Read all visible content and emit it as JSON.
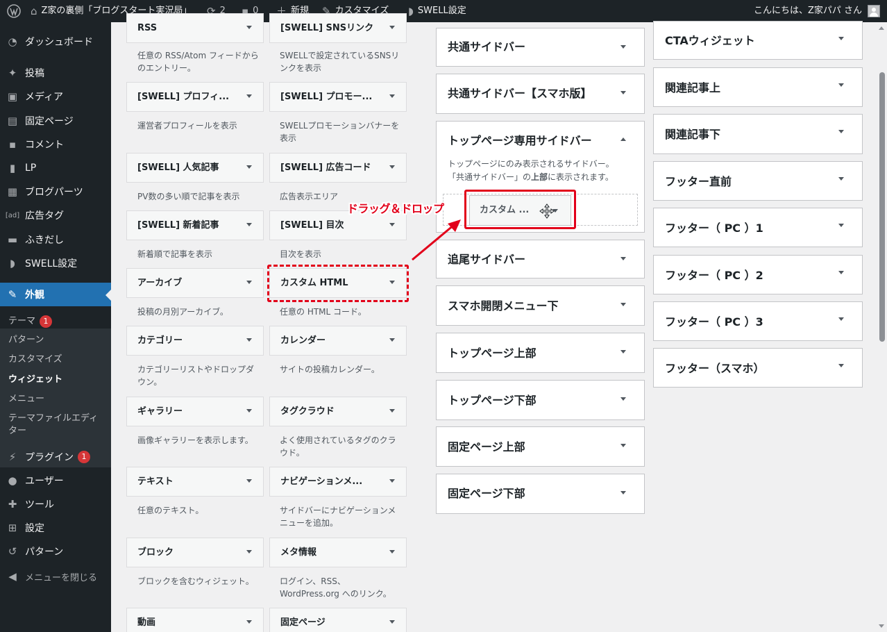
{
  "admin_bar": {
    "site_title": "Z家の裏側「ブログスタート実況局」",
    "updates_count": "2",
    "comments_count": "0",
    "new_label": "新規",
    "customize_label": "カスタマイズ",
    "swell_label": "SWELL設定",
    "greeting": "こんにちは、Z家パパ さん"
  },
  "admin_menu": {
    "items": [
      {
        "label": "ダッシュボード"
      },
      {
        "label": "投稿"
      },
      {
        "label": "メディア"
      },
      {
        "label": "固定ページ"
      },
      {
        "label": "コメント"
      },
      {
        "label": "LP"
      },
      {
        "label": "ブログパーツ"
      },
      {
        "label": "広告タグ",
        "icon_text": "[ad]"
      },
      {
        "label": "ふきだし"
      },
      {
        "label": "SWELL設定"
      },
      {
        "label": "外観"
      },
      {
        "label": "プラグイン",
        "badge": "1"
      },
      {
        "label": "ユーザー"
      },
      {
        "label": "ツール"
      },
      {
        "label": "設定"
      },
      {
        "label": "パターン"
      },
      {
        "label": "メニューを閉じる"
      }
    ],
    "submenu": [
      {
        "label": "テーマ",
        "badge": "1"
      },
      {
        "label": "パターン"
      },
      {
        "label": "カスタマイズ"
      },
      {
        "label": "ウィジェット"
      },
      {
        "label": "メニュー"
      },
      {
        "label": "テーマファイルエディター"
      }
    ]
  },
  "available_widgets": [
    {
      "title": "RSS",
      "desc": "任意の RSS/Atom フィードからのエントリー。"
    },
    {
      "title": "[SWELL] SNSリンク",
      "desc": "SWELLで設定されているSNSリンクを表示"
    },
    {
      "title": "[SWELL] プロフィ...",
      "desc": "運営者プロフィールを表示"
    },
    {
      "title": "[SWELL] プロモー...",
      "desc": "SWELLプロモーションバナーを表示"
    },
    {
      "title": "[SWELL] 人気記事",
      "desc": "PV数の多い順で記事を表示"
    },
    {
      "title": "[SWELL] 広告コード",
      "desc": "広告表示エリア"
    },
    {
      "title": "[SWELL] 新着記事",
      "desc": "新着順で記事を表示"
    },
    {
      "title": "[SWELL] 目次",
      "desc": "目次を表示"
    },
    {
      "title": "アーカイブ",
      "desc": "投稿の月別アーカイブ。"
    },
    {
      "title": "カスタム HTML",
      "desc": "任意の HTML コード。"
    },
    {
      "title": "カテゴリー",
      "desc": "カテゴリーリストやドロップダウン。"
    },
    {
      "title": "カレンダー",
      "desc": "サイトの投稿カレンダー。"
    },
    {
      "title": "ギャラリー",
      "desc": "画像ギャラリーを表示します。"
    },
    {
      "title": "タグクラウド",
      "desc": "よく使用されているタグのクラウド。"
    },
    {
      "title": "テキスト",
      "desc": "任意のテキスト。"
    },
    {
      "title": "ナビゲーションメ...",
      "desc": "サイドバーにナビゲーションメニューを追加。"
    },
    {
      "title": "ブロック",
      "desc": "ブロックを含むウィジェット。"
    },
    {
      "title": "メタ情報",
      "desc": "ログイン、RSS、WordPress.org へのリンク。"
    },
    {
      "title": "動画",
      "desc": ""
    },
    {
      "title": "固定ページ",
      "desc": ""
    }
  ],
  "middle_areas": [
    {
      "title": "共通サイドバー"
    },
    {
      "title": "共通サイドバー【スマホ版】"
    },
    {
      "title": "トップページ専用サイドバー",
      "desc_line1": "トップページにのみ表示されるサイドバー。",
      "desc_line2_pre": "「共通サイドバー」の",
      "desc_line2_bold": "上部",
      "desc_line2_post": "に表示されます。"
    },
    {
      "title": "追尾サイドバー"
    },
    {
      "title": "スマホ開閉メニュー下"
    },
    {
      "title": "トップページ上部"
    },
    {
      "title": "トップページ下部"
    },
    {
      "title": "固定ページ上部"
    },
    {
      "title": "固定ページ下部"
    }
  ],
  "right_areas": [
    {
      "title": "CTAウィジェット"
    },
    {
      "title": "関連記事上"
    },
    {
      "title": "関連記事下"
    },
    {
      "title": "フッター直前"
    },
    {
      "title": "フッター（ PC ）1"
    },
    {
      "title": "フッター（ PC ）2"
    },
    {
      "title": "フッター（ PC ）3"
    },
    {
      "title": "フッター（スマホ）"
    }
  ],
  "dragged_widget": {
    "title": "カスタム ..."
  },
  "annotation": {
    "label": "ドラッグ＆ドロップ",
    "color": "#e2001a"
  },
  "colors": {
    "admin_bg": "#1d2327",
    "accent": "#2271b1",
    "badge": "#d63638"
  }
}
